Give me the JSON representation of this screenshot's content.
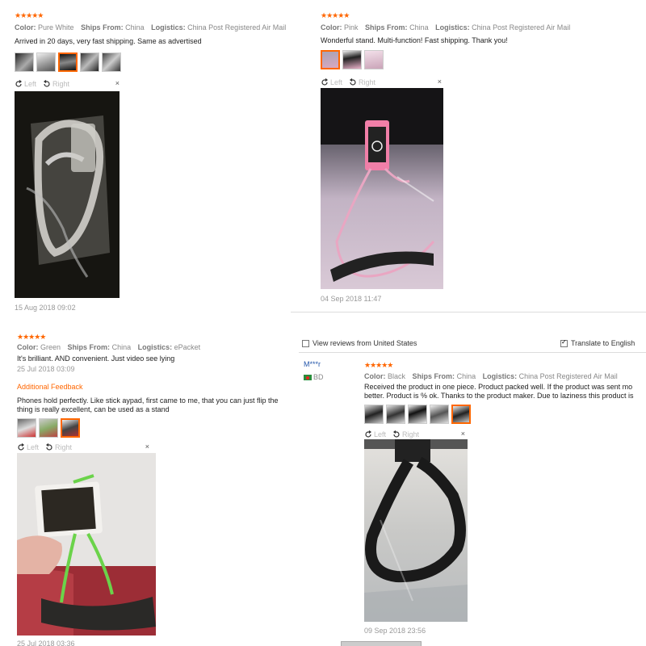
{
  "stars": "★★★★★",
  "labels": {
    "color": "Color:",
    "ships_from": "Ships From:",
    "logistics": "Logistics:"
  },
  "viewer": {
    "left": "Left",
    "right": "Right",
    "close": "×"
  },
  "reviews": [
    {
      "color": "Pure White",
      "ships_from": "China",
      "logistics": "China Post Registered Air Mail",
      "text": "Arrived in 20 days, very fast shipping. Same as advertised",
      "date": "15 Aug 2018 09:02"
    },
    {
      "color": "Pink",
      "ships_from": "China",
      "logistics": "China Post Registered Air Mail",
      "text": "Wonderful stand. Multi-function! Fast shipping. Thank you!",
      "date": "04 Sep 2018 11:47"
    },
    {
      "color": "Green",
      "ships_from": "China",
      "logistics": "ePacket",
      "text": "It's brilliant. AND convenient. Just video see lying",
      "date": "25 Jul 2018 03:09",
      "additional_feedback_label": "Additional Feedback",
      "additional_text_1": "Phones hold perfectly. Like stick aypad, first came to me, that you can just flip the",
      "additional_text_2": "thing is really excellent, can be used as a stand",
      "additional_date": "25 Jul 2018 03:36"
    },
    {
      "reviewer": "M***r",
      "country": "BD",
      "color": "Black",
      "ships_from": "China",
      "logistics": "China Post Registered Air Mail",
      "text_1": "Received the product in one piece. Product packed well. If the product was sent mo",
      "text_2": "better. Product is % ok. Thanks to the product maker. Due to laziness this product is",
      "date": "09 Sep 2018 23:56"
    }
  ],
  "filters": {
    "view_from_us": "View reviews from United States",
    "translate": "Translate to English",
    "translate_checked": true
  },
  "colors": {
    "accent": "#ff6600",
    "reviewer": "#2255aa"
  }
}
